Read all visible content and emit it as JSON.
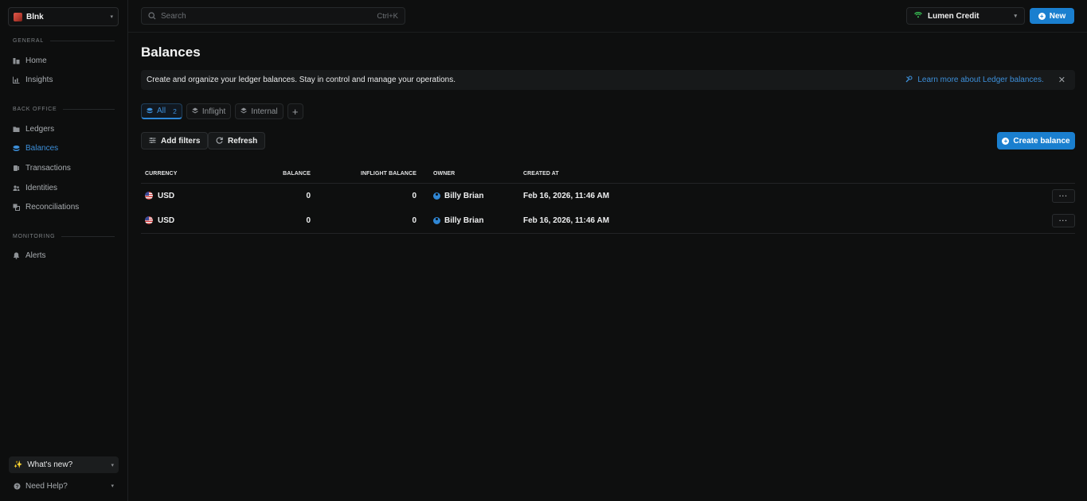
{
  "workspace": {
    "name": "Blnk"
  },
  "sidebar": {
    "sections": {
      "general": "GENERAL",
      "back_office": "BACK OFFICE",
      "monitoring": "MONITORING"
    },
    "items": {
      "home": "Home",
      "insights": "Insights",
      "ledgers": "Ledgers",
      "balances": "Balances",
      "transactions": "Transactions",
      "identities": "Identities",
      "reconciliations": "Reconciliations",
      "alerts": "Alerts"
    },
    "whats_new": "What's new?",
    "need_help": "Need Help?"
  },
  "topbar": {
    "search_placeholder": "Search",
    "search_shortcut": "Ctrl+K",
    "ledger": "Lumen Credit",
    "new_label": "New"
  },
  "page": {
    "title": "Balances",
    "banner_text": "Create and organize your ledger balances. Stay in control and manage your operations.",
    "banner_link": "Learn more about Ledger balances."
  },
  "tabs": [
    {
      "label": "All",
      "count": "2"
    },
    {
      "label": "Inflight"
    },
    {
      "label": "Internal"
    }
  ],
  "toolbar": {
    "add_filters": "Add filters",
    "refresh": "Refresh",
    "create_balance": "Create balance"
  },
  "table": {
    "columns": {
      "currency": "CURRENCY",
      "balance": "BALANCE",
      "inflight": "INFLIGHT BALANCE",
      "owner": "OWNER",
      "created": "CREATED AT"
    },
    "rows": [
      {
        "currency": "USD",
        "balance": "0",
        "inflight": "0",
        "owner": "Billy Brian",
        "created": "Feb 16, 2026, 11:46 AM",
        "actions": "···"
      },
      {
        "currency": "USD",
        "balance": "0",
        "inflight": "0",
        "owner": "Billy Brian",
        "created": "Feb 16, 2026, 11:46 AM",
        "actions": "···"
      }
    ]
  },
  "colors": {
    "accent": "#1a7fcf",
    "link": "#3d8fd9",
    "background": "#0e0f0f",
    "status_green": "#3ccf5a"
  }
}
